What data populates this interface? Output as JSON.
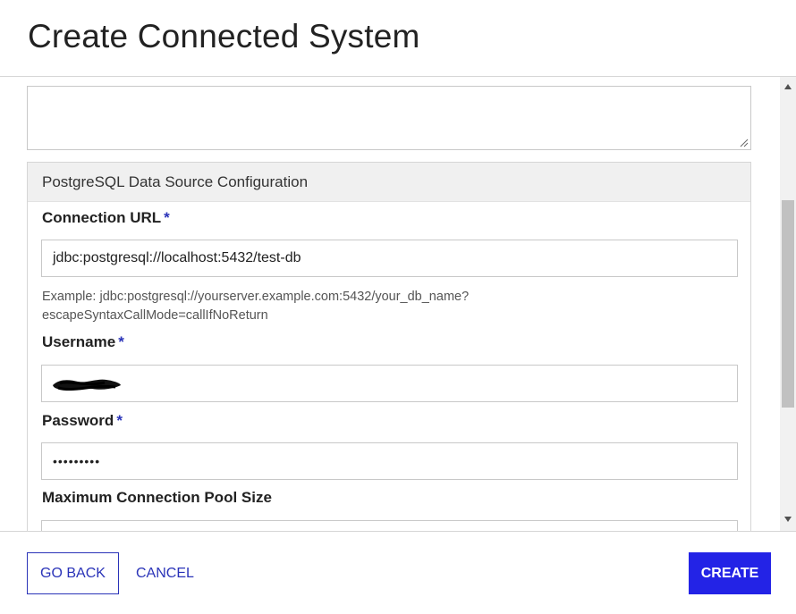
{
  "dialog": {
    "title": "Create Connected System"
  },
  "panel": {
    "title": "PostgreSQL Data Source Configuration",
    "fields": {
      "connection_url": {
        "label": "Connection URL",
        "required_marker": "*",
        "value": "jdbc:postgresql://localhost:5432/test-db",
        "hint_line1": "Example: jdbc:postgresql://yourserver.example.com:5432/your_db_name?",
        "hint_line2": "escapeSyntaxCallMode=callIfNoReturn"
      },
      "username": {
        "label": "Username",
        "required_marker": "*",
        "value_redacted": true
      },
      "password": {
        "label": "Password",
        "required_marker": "*",
        "value": "•••••••••"
      },
      "max_pool_size": {
        "label": "Maximum Connection Pool Size",
        "value": ""
      }
    }
  },
  "footer": {
    "back_label": "GO BACK",
    "cancel_label": "CANCEL",
    "create_label": "CREATE"
  },
  "colors": {
    "accent": "#2a33b8",
    "primary_button": "#2323e6"
  }
}
